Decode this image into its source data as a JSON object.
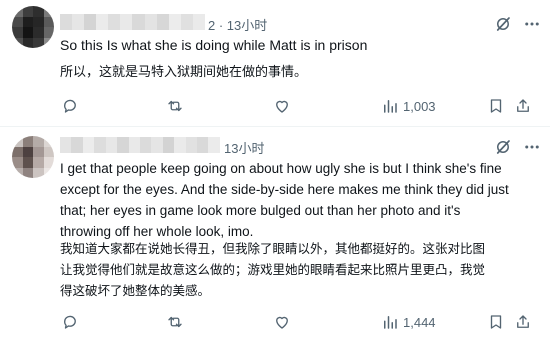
{
  "colors": {
    "text": "#0f1419",
    "muted": "#536471",
    "divider": "#eff3f4",
    "background": "#ffffff"
  },
  "posts": [
    {
      "meta_suffix": "2 · 13小时",
      "text_en": "So this Is what she is doing while Matt is in prison",
      "text_zh": "所以，这就是马特入狱期间她在做的事情。",
      "views": "1,003",
      "icons": [
        "reply-icon",
        "retweet-icon",
        "like-icon",
        "views-icon",
        "bookmark-icon",
        "share-icon",
        "grok-icon",
        "more-icon"
      ]
    },
    {
      "meta_suffix": "13小时",
      "text_en": "I get that people keep going on about how ugly she is but I think she's fine\nexcept for the eyes. And the side-by-side here makes me think they did just\nthat; her eyes in game look more bulged out than her photo and it's\nthrowing off her whole look, imo.",
      "text_zh": "我知道大家都在说她长得丑，但我除了眼睛以外，其他都挺好的。这张对比图\n让我觉得他们就是故意这么做的；游戏里她的眼睛看起来比照片里更凸，我觉\n得这破坏了她整体的美感。",
      "views": "1,444",
      "icons": [
        "reply-icon",
        "retweet-icon",
        "like-icon",
        "views-icon",
        "bookmark-icon",
        "share-icon",
        "grok-icon",
        "more-icon"
      ]
    }
  ]
}
